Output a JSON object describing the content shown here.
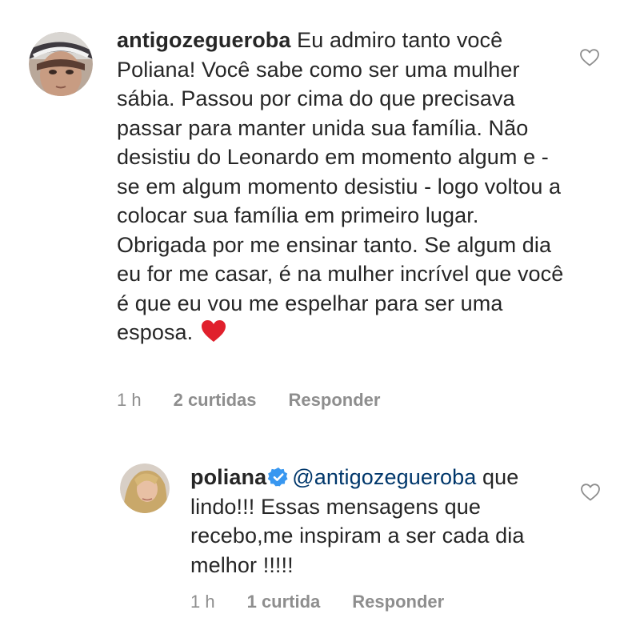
{
  "comments": [
    {
      "username": "antigozegueroba",
      "text": "Eu admiro tanto você Poliana! Você sabe como ser uma mulher sábia. Passou por cima do que precisava passar para manter unida sua família. Não desistiu do Leonardo em momento algum e - se em algum momento desistiu - logo voltou a colocar sua família em primeiro lugar. Obrigada por me ensinar tanto. Se algum dia eu for me casar, é na mulher incrível que você é que eu vou me espelhar para ser uma esposa.",
      "emoji": "heart-emoji",
      "time": "1 h",
      "likes": "2 curtidas",
      "reply_label": "Responder",
      "like_icon": "heart-outline-icon"
    }
  ],
  "reply": {
    "username": "poliana",
    "verified": true,
    "mention": "@antigozegueroba",
    "text": "que lindo!!! Essas mensagens que recebo,me inspiram  a ser cada dia melhor !!!!!",
    "time": "1 h",
    "likes": "1 curtida",
    "reply_label": "Responder",
    "like_icon": "heart-outline-icon"
  },
  "colors": {
    "text": "#262626",
    "meta": "#8e8e8e",
    "mention": "#00376b",
    "verified": "#3897f0",
    "heart_emoji": "#e0202c"
  }
}
